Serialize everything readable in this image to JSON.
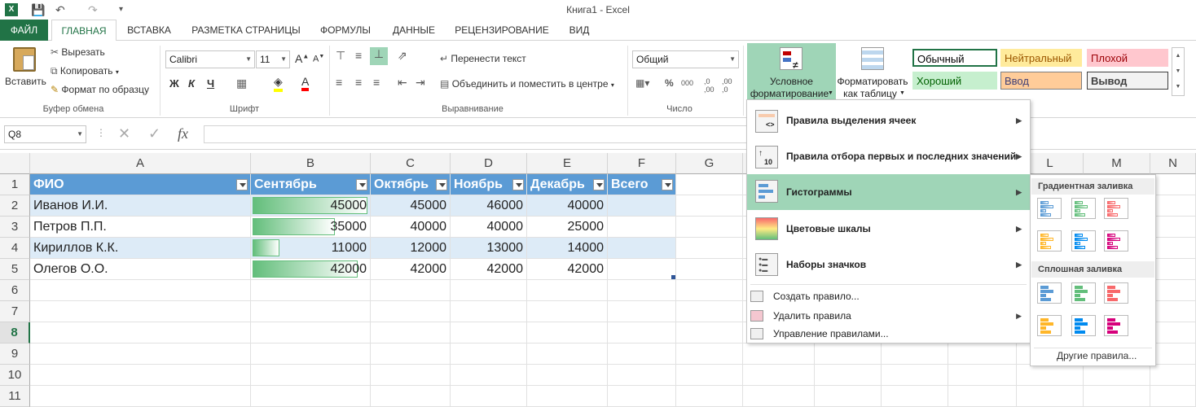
{
  "window": {
    "title": "Книга1 - Excel"
  },
  "tabs": [
    "ФАЙЛ",
    "ГЛАВНАЯ",
    "ВСТАВКА",
    "РАЗМЕТКА СТРАНИЦЫ",
    "ФОРМУЛЫ",
    "ДАННЫЕ",
    "РЕЦЕНЗИРОВАНИЕ",
    "ВИД"
  ],
  "ribbon": {
    "clipboard": {
      "paste": "Вставить",
      "cut": "Вырезать",
      "copy": "Копировать",
      "format_painter": "Формат по образцу",
      "label": "Буфер обмена"
    },
    "font": {
      "name": "Calibri",
      "size": "11",
      "bold": "Ж",
      "italic": "К",
      "underline": "Ч",
      "label": "Шрифт"
    },
    "alignment": {
      "wrap": "Перенести текст",
      "merge": "Объединить и поместить в центре",
      "label": "Выравнивание"
    },
    "number": {
      "format": "Общий",
      "label": "Число"
    },
    "styles": {
      "conditional": "Условное форматирование",
      "conditional_l1": "Условное",
      "conditional_l2": "форматирование",
      "as_table_l1": "Форматировать",
      "as_table_l2": "как таблицу",
      "cells": [
        {
          "text": "Обычный",
          "bg": "#ffffff",
          "border": "#217346",
          "color": "#000000"
        },
        {
          "text": "Нейтральный",
          "bg": "#ffeb9c",
          "border": "#ffeb9c",
          "color": "#9c5700"
        },
        {
          "text": "Плохой",
          "bg": "#ffc7ce",
          "border": "#ffc7ce",
          "color": "#9c0006"
        },
        {
          "text": "Хороший",
          "bg": "#c6efce",
          "border": "#c6efce",
          "color": "#006100"
        },
        {
          "text": "Ввод",
          "bg": "#ffcc99",
          "border": "#7f7f7f",
          "color": "#3f3f76"
        },
        {
          "text": "Вывод",
          "bg": "#f2f2f2",
          "border": "#3f3f3f",
          "color": "#3f3f3f"
        }
      ]
    }
  },
  "formula_bar": {
    "name_box": "Q8",
    "fx": "fx",
    "value": ""
  },
  "columns": [
    "A",
    "B",
    "C",
    "D",
    "E",
    "F",
    "G",
    "",
    "",
    "",
    "",
    "L",
    "M",
    "N"
  ],
  "rows": [
    "1",
    "2",
    "3",
    "4",
    "5",
    "6",
    "7",
    "8",
    "9",
    "10",
    "11"
  ],
  "table": {
    "headers": [
      "ФИО",
      "Сентябрь",
      "Октябрь",
      "Ноябрь",
      "Декабрь",
      "Всего"
    ],
    "data": [
      {
        "name": "Иванов И.И.",
        "sep": "45000",
        "oct": "45000",
        "nov": "46000",
        "dec": "40000",
        "bar": 1.0
      },
      {
        "name": "Петров П.П.",
        "sep": "35000",
        "oct": "40000",
        "nov": "40000",
        "dec": "25000",
        "bar": 0.714
      },
      {
        "name": "Кириллов К.К.",
        "sep": "11000",
        "oct": "12000",
        "nov": "13000",
        "dec": "14000",
        "bar": 0.235
      },
      {
        "name": "Олегов    О.О.",
        "sep": "42000",
        "oct": "42000",
        "nov": "42000",
        "dec": "42000",
        "bar": 0.914
      }
    ]
  },
  "cf_menu": {
    "items": [
      "Правила выделения ячеек",
      "Правила отбора первых и последних значений",
      "Гистограммы",
      "Цветовые шкалы",
      "Наборы значков"
    ],
    "small": [
      "Создать правило...",
      "Удалить правила",
      "Управление правилами..."
    ]
  },
  "databar_menu": {
    "gradient": "Градиентная заливка",
    "solid": "Сплошная заливка",
    "more": "Другие правила...",
    "colors": [
      "#5b9bd5",
      "#63be7b",
      "#f8696b",
      "#ffb628",
      "#008aef",
      "#d6007b"
    ]
  }
}
